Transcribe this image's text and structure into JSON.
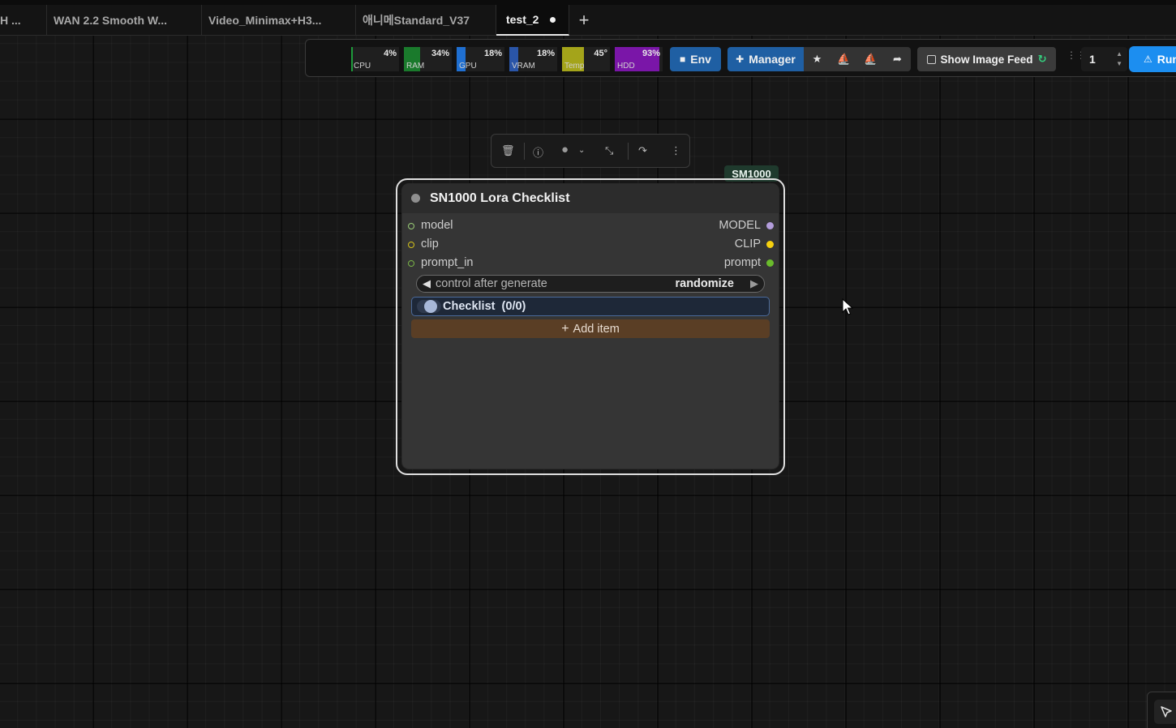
{
  "tabs": [
    {
      "label": "H ..."
    },
    {
      "label": "WAN 2.2 Smooth W..."
    },
    {
      "label": "Video_Minimax+H3..."
    },
    {
      "label": "애니메Standard_V37"
    },
    {
      "label": "test_2",
      "active": true,
      "unsaved": true
    }
  ],
  "tab_add_symbol": "+",
  "monitors": [
    {
      "label": "CPU",
      "value": "4%",
      "fraction": 0.04,
      "color": "#1e9a3a"
    },
    {
      "label": "RAM",
      "value": "34%",
      "fraction": 0.34,
      "color": "#1a7a2c"
    },
    {
      "label": "GPU",
      "value": "18%",
      "fraction": 0.18,
      "color": "#1f6fd1"
    },
    {
      "label": "VRAM",
      "value": "18%",
      "fraction": 0.18,
      "color": "#2a55a8"
    },
    {
      "label": "Temp",
      "value": "45°",
      "fraction": 0.45,
      "color": "#a4a41a"
    },
    {
      "label": "HDD",
      "value": "93%",
      "fraction": 0.93,
      "color": "#7a16a8"
    }
  ],
  "toolbar": {
    "env_label": "Env",
    "manager_label": "Manager",
    "show_image_feed_label": "Show Image Feed",
    "batch_count": "1",
    "run_label": "Run"
  },
  "node": {
    "badge": "SM1000",
    "title": "SN1000 Lora Checklist",
    "slots": [
      {
        "input": "model",
        "output": "MODEL",
        "in_color": "#9acd77",
        "out_color": "#b39ddb"
      },
      {
        "input": "clip",
        "output": "CLIP",
        "in_color": "#d4c21a",
        "out_color": "#f5d00f"
      },
      {
        "input": "prompt_in",
        "output": "prompt",
        "in_color": "#7ab547",
        "out_color": "#6abb2c"
      }
    ],
    "combo": {
      "label": "control after generate",
      "value": "randomize"
    },
    "checklist_label": "Checklist",
    "checklist_count": "(0/0)",
    "add_item_label": "Add item"
  }
}
